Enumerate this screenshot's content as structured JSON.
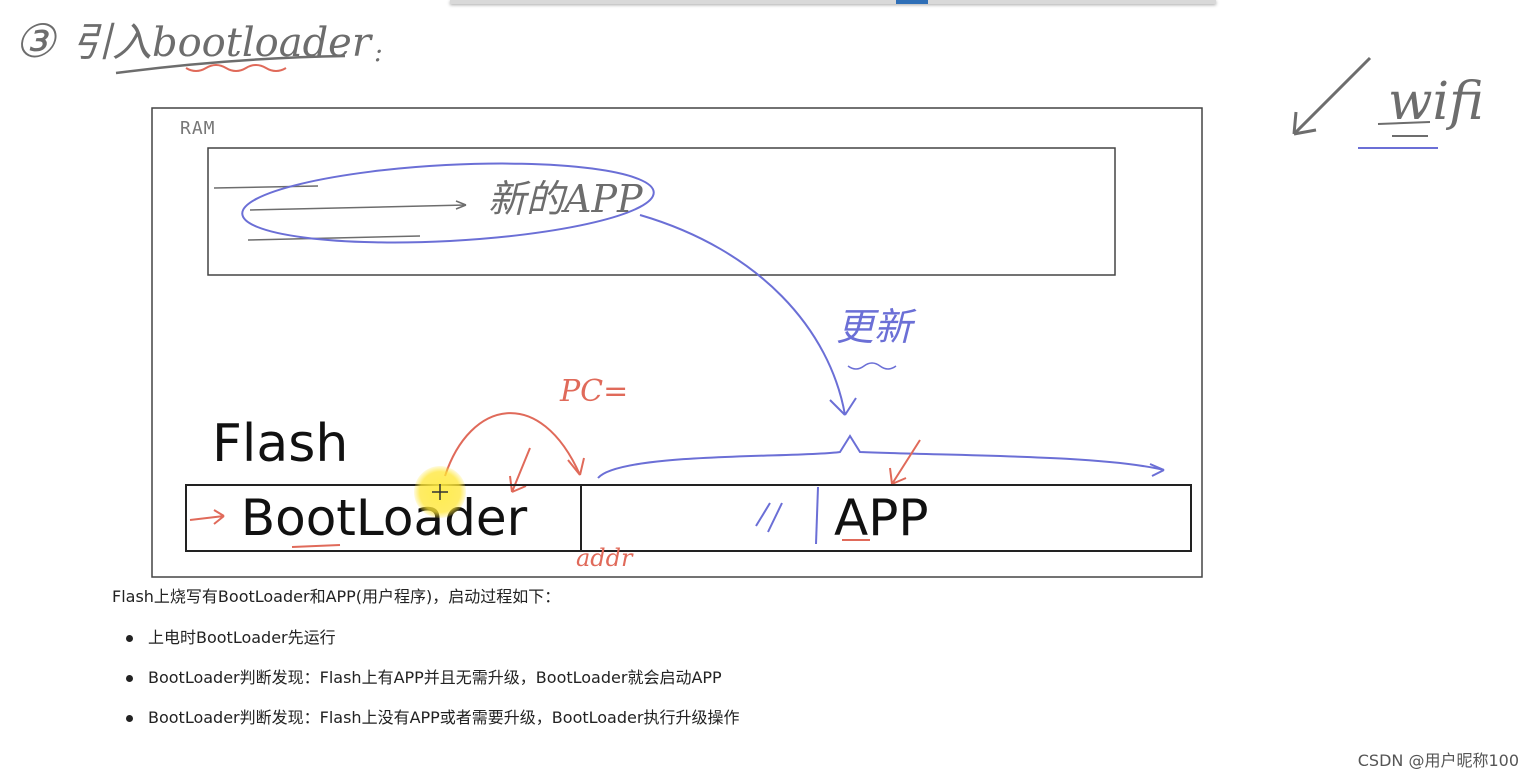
{
  "heading": {
    "number": "③",
    "text": "引入bootloader",
    "colon": ":"
  },
  "side_note": {
    "text": "wifi"
  },
  "diagram": {
    "ram_label": "RAM",
    "ram_note": "新的APP",
    "update_note": "更新",
    "pc_note": "PC=",
    "flash_label": "Flash",
    "bootloader_label": "BootLoader",
    "app_label": "APP",
    "addr_note": "addr"
  },
  "caption": {
    "text": "Flash上烧写有BootLoader和APP(用户程序)，启动过程如下："
  },
  "bullets": [
    {
      "text": "上电时BootLoader先运行"
    },
    {
      "text": "BootLoader判断发现：Flash上有APP并且无需升级，BootLoader就会启动APP"
    },
    {
      "text": "BootLoader判断发现：Flash上没有APP或者需要升级，BootLoader执行升级操作"
    }
  ],
  "watermark": {
    "text": "CSDN @用户昵称100"
  },
  "colors": {
    "pen_blue": "#6b6fd6",
    "pen_red": "#e06a5a",
    "pen_gray": "#6d6d6d",
    "box_border": "#333333",
    "highlight": "#ffe84a"
  },
  "icons": {
    "cursor": "crosshair-cursor-icon"
  }
}
